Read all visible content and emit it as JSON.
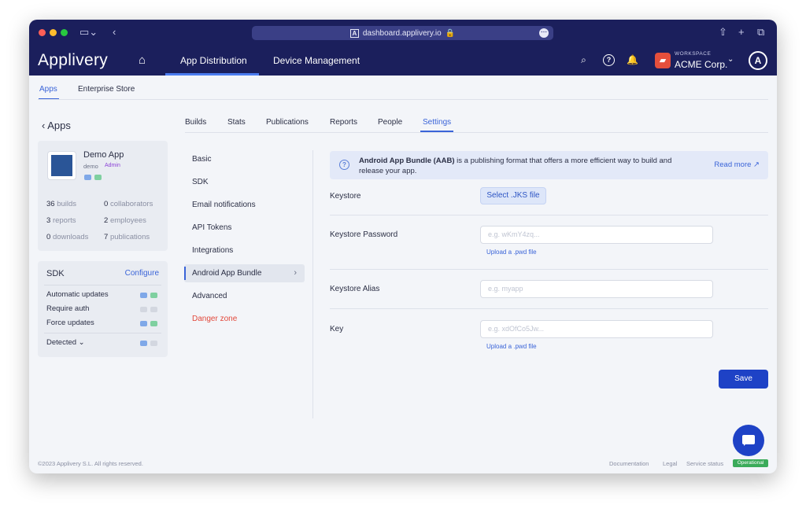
{
  "browser": {
    "url": "dashboard.applivery.io"
  },
  "header": {
    "logo": "Applivery",
    "nav": [
      "App Distribution",
      "Device Management"
    ],
    "workspace_label": "WORKSPACE",
    "workspace_name": "ACME Corp."
  },
  "subnav": {
    "tabs": [
      "Apps",
      "Enterprise Store"
    ]
  },
  "left": {
    "back_label": "Apps",
    "app": {
      "name": "Demo App",
      "slug": "demo",
      "role": "Admin"
    },
    "stats": [
      {
        "value": "36",
        "label": "builds"
      },
      {
        "value": "0",
        "label": "collaborators"
      },
      {
        "value": "3",
        "label": "reports"
      },
      {
        "value": "2",
        "label": "employees"
      },
      {
        "value": "0",
        "label": "downloads"
      },
      {
        "value": "7",
        "label": "publications"
      }
    ],
    "sdk": {
      "title": "SDK",
      "configure": "Configure",
      "rows": [
        "Automatic updates",
        "Require auth",
        "Force updates",
        "Detected"
      ]
    }
  },
  "tabs": [
    "Builds",
    "Stats",
    "Publications",
    "Reports",
    "People",
    "Settings"
  ],
  "menu": [
    "Basic",
    "SDK",
    "Email notifications",
    "API Tokens",
    "Integrations",
    "Android App Bundle",
    "Advanced",
    "Danger zone"
  ],
  "info": {
    "bold": "Android App Bundle (AAB)",
    "text": " is a publishing format that offers a more efficient way to build and release your app.",
    "read_more": "Read more"
  },
  "form": {
    "keystore_label": "Keystore",
    "keystore_button": "Select .JKS file",
    "password_label": "Keystore Password",
    "password_placeholder": "e.g. wKmY4zq...",
    "upload_pwd": "Upload a .pwd file",
    "alias_label": "Keystore Alias",
    "alias_placeholder": "e.g. myapp",
    "key_label": "Key",
    "key_placeholder": "e.g. xdOfCo5Jw...",
    "upload_pwd_2": "Upload a .pwd file",
    "save": "Save"
  },
  "footer": {
    "copyright": "©2023 Applivery S.L. All rights reserved.",
    "links": [
      "Documentation",
      "Legal",
      "Service status"
    ],
    "status": "Operational"
  },
  "colors": {
    "header_bg": "#1b1f5c",
    "accent": "#3a64d8",
    "primary_button": "#1e42c6",
    "danger": "#e2483b",
    "operational": "#3bab5a"
  },
  "icons": [
    "sidebar-toggle-icon",
    "back-arrow-icon",
    "lock-icon",
    "share-icon",
    "new-tab-icon",
    "tabs-icon",
    "home-icon",
    "search-icon",
    "help-icon",
    "bell-icon",
    "chevron-down-icon",
    "info-icon",
    "external-link-icon",
    "chat-icon",
    "apple-icon",
    "android-icon"
  ]
}
